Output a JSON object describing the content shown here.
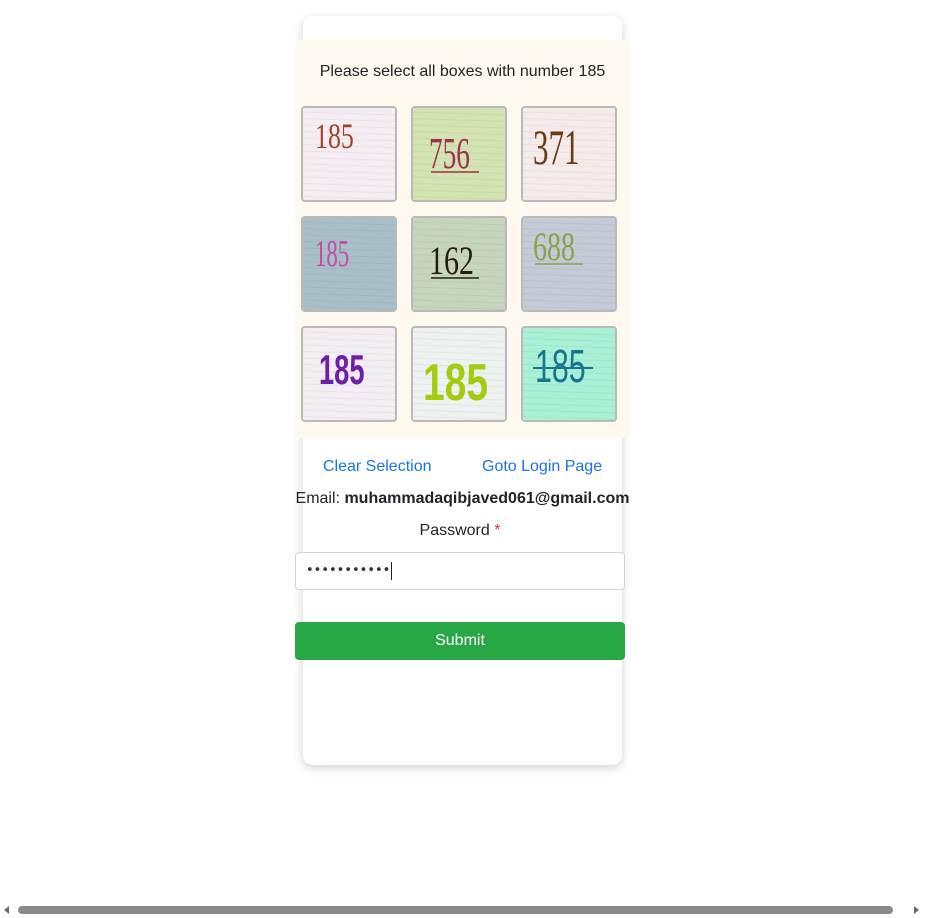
{
  "captcha": {
    "instruction": "Please select all boxes with number 185",
    "tiles": [
      {
        "number": "185",
        "color": "#a0452a",
        "bg": "#f4eef4",
        "style": "plain"
      },
      {
        "number": "756",
        "color": "#a03050",
        "bg": "#d3e3b2",
        "style": "underline"
      },
      {
        "number": "371",
        "color": "#6a3a16",
        "bg": "#f5ebeb",
        "style": "plain"
      },
      {
        "number": "185",
        "color": "#c44aa6",
        "bg": "#a9bfc7",
        "style": "plain"
      },
      {
        "number": "162",
        "color": "#2a1a10",
        "bg": "#c6d6bd",
        "style": "underline"
      },
      {
        "number": "688",
        "color": "#8aa34a",
        "bg": "#c5cad6",
        "style": "underline"
      },
      {
        "number": "185",
        "color": "#6e1fa3",
        "bg": "#f3eef4",
        "style": "plain"
      },
      {
        "number": "185",
        "color": "#a3cc10",
        "bg": "#eef2f1",
        "style": "bold"
      },
      {
        "number": "185",
        "color": "#16758f",
        "bg": "#a8f0d6",
        "style": "strike"
      }
    ]
  },
  "links": {
    "clear_selection": "Clear Selection",
    "goto_login": "Goto Login Page"
  },
  "account": {
    "email_label": "Email:",
    "email_value": "muhammadaqibjaved061@gmail.com"
  },
  "password": {
    "label": "Password",
    "required_mark": "*",
    "masked_value": "•••••••••••"
  },
  "submit": {
    "label": "Submit"
  },
  "colors": {
    "link": "#1a73e8",
    "submit_bg": "#28a745",
    "required": "#dc3545",
    "captcha_panel_bg": "#fdf9ef"
  },
  "icons": {
    "scroll_left": "scroll-left-arrow-icon",
    "scroll_right": "scroll-right-arrow-icon"
  }
}
